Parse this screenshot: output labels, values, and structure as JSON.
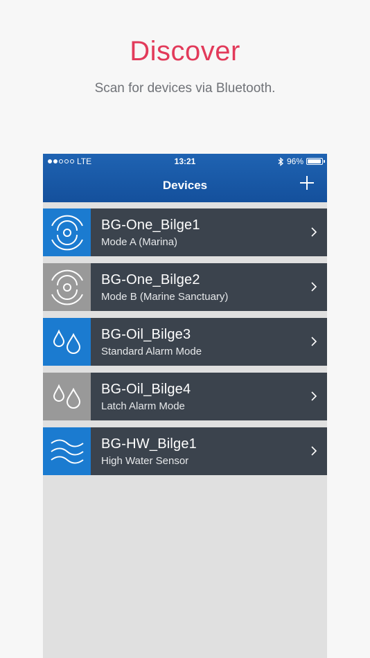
{
  "hero": {
    "title": "Discover",
    "subtitle": "Scan for devices via Bluetooth."
  },
  "status_bar": {
    "carrier": "LTE",
    "time": "13:21",
    "battery_text": "96%",
    "battery_level": 0.96
  },
  "navbar": {
    "title": "Devices"
  },
  "devices": [
    {
      "name": "BG-One_Bilge1",
      "mode": "Mode A (Marina)",
      "icon": "sensor-icon",
      "tile_color": "#1b7bd0"
    },
    {
      "name": "BG-One_Bilge2",
      "mode": "Mode B (Marine Sanctuary)",
      "icon": "sensor-icon",
      "tile_color": "#999999"
    },
    {
      "name": "BG-Oil_Bilge3",
      "mode": "Standard Alarm Mode",
      "icon": "oil-drops-icon",
      "tile_color": "#1b7bd0"
    },
    {
      "name": "BG-Oil_Bilge4",
      "mode": "Latch Alarm Mode",
      "icon": "oil-drops-icon",
      "tile_color": "#999999"
    },
    {
      "name": "BG-HW_Bilge1",
      "mode": "High Water Sensor",
      "icon": "water-waves-icon",
      "tile_color": "#1b7bd0"
    }
  ],
  "colors": {
    "accent": "#e23a5a",
    "nav_blue": "#14509c",
    "row_bg": "#3b434d"
  }
}
